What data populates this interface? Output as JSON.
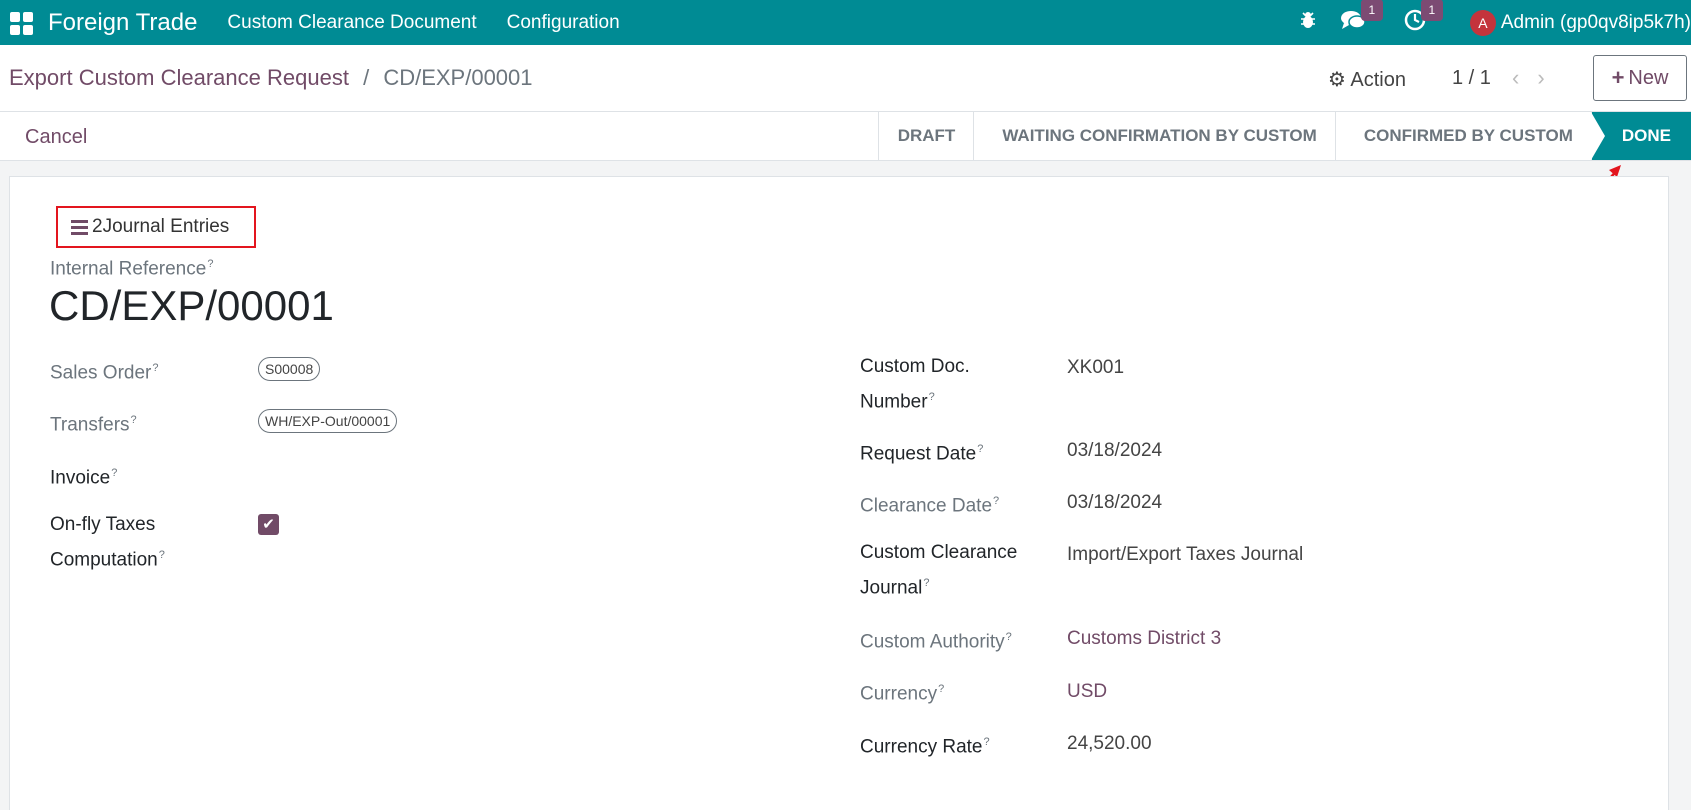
{
  "topnav": {
    "brand": "Foreign Trade",
    "menu": [
      "Custom Clearance Document",
      "Configuration"
    ],
    "chat_count": "1",
    "activity_count": "1",
    "avatar_letter": "A",
    "user": "Admin (gp0qv8ip5k7h)"
  },
  "control": {
    "breadcrumb_parent": "Export Custom Clearance Request",
    "breadcrumb_sep": "/",
    "breadcrumb_current": "CD/EXP/00001",
    "action_label": "Action",
    "pager": "1 / 1",
    "new_label": "New"
  },
  "statusbar": {
    "cancel_label": "Cancel",
    "stages": [
      "DRAFT",
      "WAITING CONFIRMATION BY CUSTOM",
      "CONFIRMED BY CUSTOM",
      "DONE"
    ],
    "active_stage": "DONE"
  },
  "sheet": {
    "smart_button_count": "2",
    "smart_button_label": "Journal Entries",
    "ref_label": "Internal Reference",
    "ref_value": "CD/EXP/00001",
    "left_fields": {
      "sales_order_label": "Sales Order",
      "sales_order_value": "S00008",
      "transfers_label": "Transfers",
      "transfers_value": "WH/EXP-Out/00001",
      "invoice_label": "Invoice",
      "onfly_label_1": "On-fly Taxes",
      "onfly_label_2": "Computation",
      "onfly_checked": true
    },
    "right_fields": {
      "doc_number_label_1": "Custom Doc.",
      "doc_number_label_2": "Number",
      "doc_number_value": "XK001",
      "request_date_label": "Request Date",
      "request_date_value": "03/18/2024",
      "clearance_date_label": "Clearance Date",
      "clearance_date_value": "03/18/2024",
      "journal_label_1": "Custom Clearance",
      "journal_label_2": "Journal",
      "journal_value": "Import/Export Taxes Journal",
      "authority_label": "Custom Authority",
      "authority_value": "Customs District 3",
      "currency_label": "Currency",
      "currency_value": "USD",
      "rate_label": "Currency Rate",
      "rate_value": "24,520.00"
    },
    "help_mark": "?"
  },
  "colors": {
    "brand": "#008b94",
    "accent": "#714b67",
    "highlight_box": "#e3151e"
  }
}
